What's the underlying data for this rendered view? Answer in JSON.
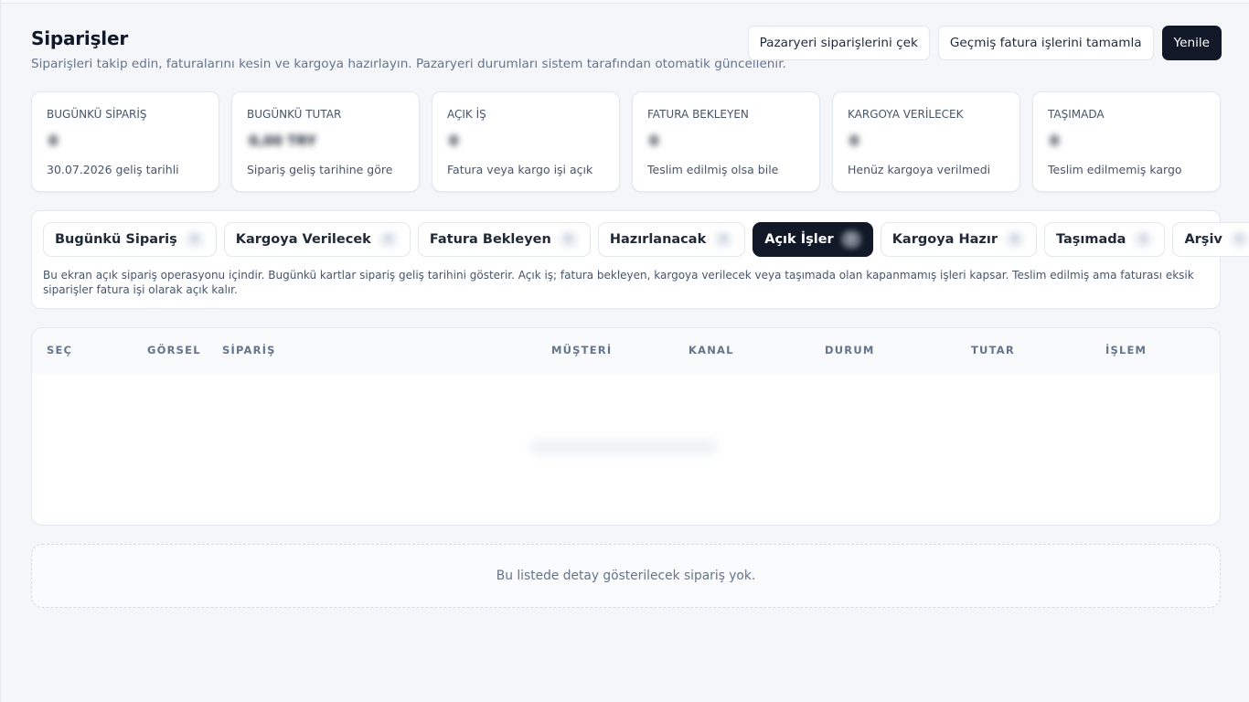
{
  "header": {
    "title": "Siparişler",
    "subtitle": "Siparişleri takip edin, faturalarını kesin ve kargoya hazırlayın. Pazaryeri durumları sistem tarafından otomatik güncellenir.",
    "actions": {
      "fetch_label": "Pazaryeri siparişlerini çek",
      "complete_label": "Geçmiş fatura işlerini tamamla",
      "refresh_label": "Yenile"
    }
  },
  "stats": [
    {
      "label": "BUGÜNKÜ SİPARİŞ",
      "value": "0",
      "hint": "30.07.2026 geliş tarihli"
    },
    {
      "label": "BUGÜNKÜ TUTAR",
      "value": "0,00 TRY",
      "hint": "Sipariş geliş tarihine göre"
    },
    {
      "label": "AÇIK İŞ",
      "value": "0",
      "hint": "Fatura veya kargo işi açık"
    },
    {
      "label": "FATURA BEKLEYEN",
      "value": "0",
      "hint": "Teslim edilmiş olsa bile"
    },
    {
      "label": "KARGOYA VERİLECEK",
      "value": "0",
      "hint": "Henüz kargoya verilmedi"
    },
    {
      "label": "TAŞIMADA",
      "value": "0",
      "hint": "Teslim edilmemiş kargo"
    }
  ],
  "tabs": [
    {
      "label": "Bugünkü Sipariş",
      "count": "0"
    },
    {
      "label": "Kargoya Verilecek",
      "count": "0"
    },
    {
      "label": "Fatura Bekleyen",
      "count": "0"
    },
    {
      "label": "Hazırlanacak",
      "count": "0"
    },
    {
      "label": "Açık İşler",
      "count": "0",
      "active": true
    },
    {
      "label": "Kargoya Hazır",
      "count": "0"
    },
    {
      "label": "Taşımada",
      "count": "0"
    },
    {
      "label": "Arşiv",
      "count": "0"
    }
  ],
  "tabs_note": "Bu ekran açık sipariş operasyonu içindir. Bugünkü kartlar sipariş geliş tarihini gösterir. Açık iş; fatura bekleyen, kargoya verilecek veya taşımada olan kapanmamış işleri kapsar. Teslim edilmiş ama faturası eksik siparişler fatura işi olarak açık kalır.",
  "table": {
    "columns": [
      "SEÇ",
      "GÖRSEL",
      "SİPARİŞ",
      "MÜŞTERİ",
      "KANAL",
      "DURUM",
      "TUTAR",
      "İŞLEM"
    ]
  },
  "empty_message": "Bu listede detay gösterilecek sipariş yok.",
  "colors": {
    "background": "#f4f6fa",
    "primary": "#111827",
    "muted_text": "#64748b",
    "border": "#e3e7ee"
  }
}
